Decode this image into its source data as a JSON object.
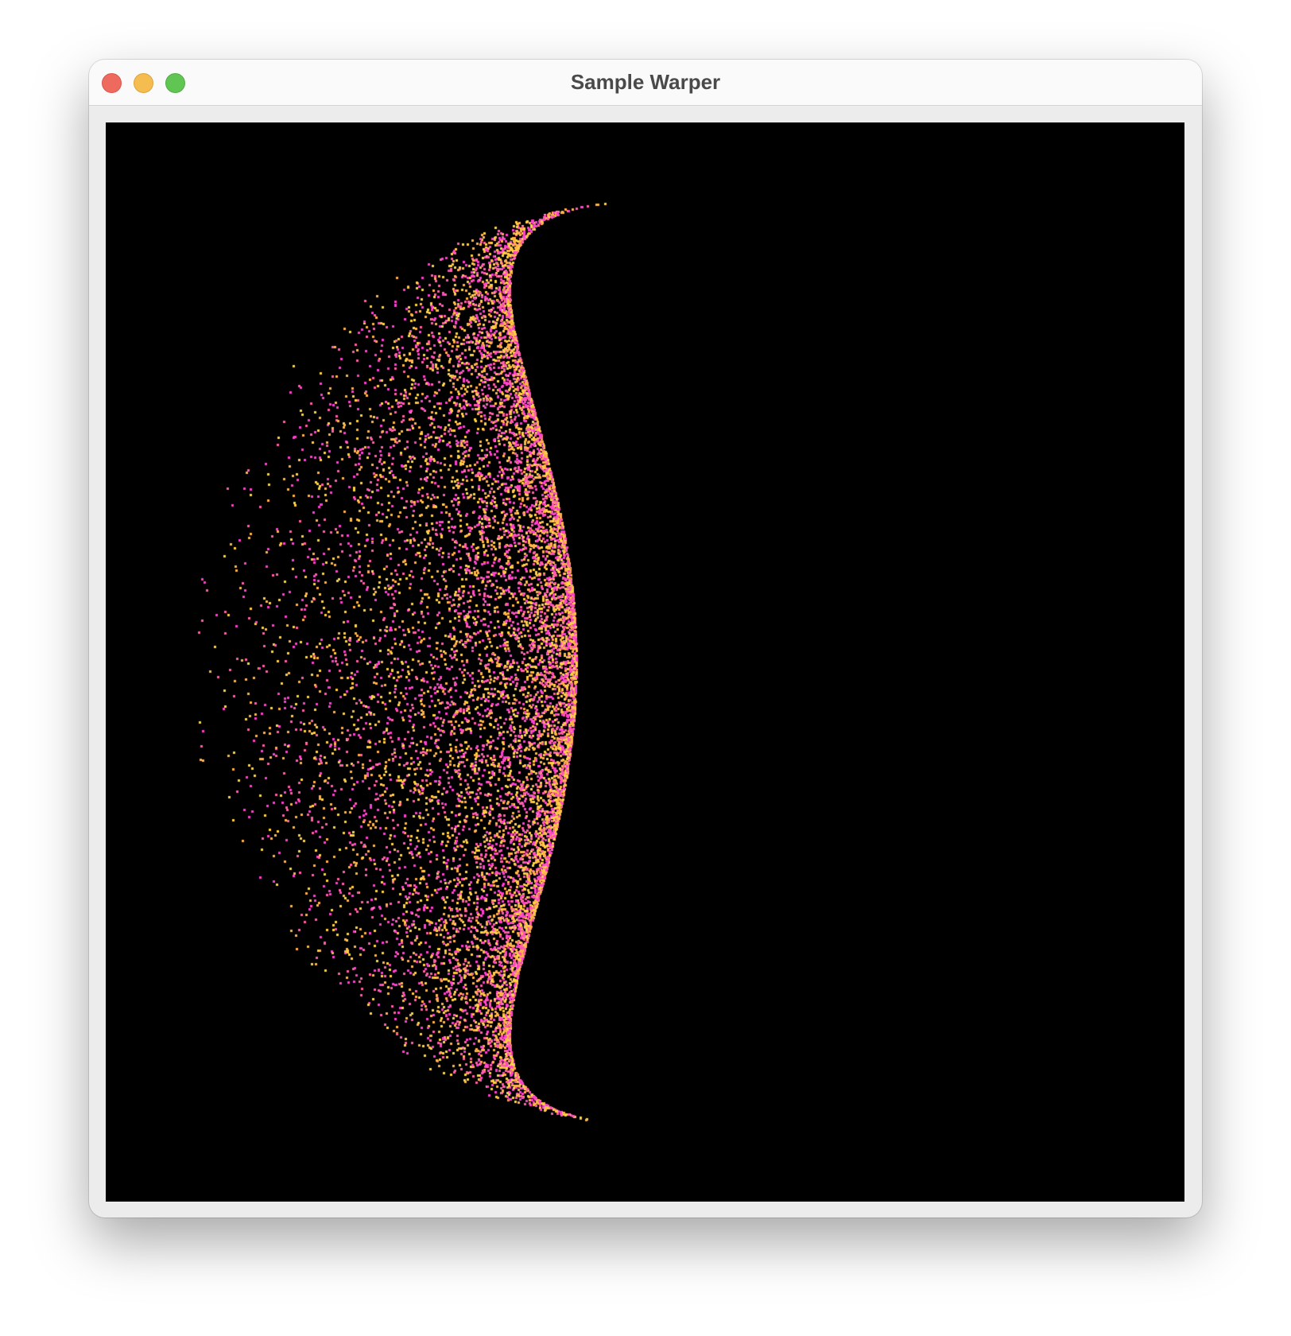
{
  "window": {
    "title": "Sample Warper"
  },
  "controls": {
    "close": "close-button",
    "minimize": "minimize-button",
    "zoom": "zoom-button"
  },
  "visualization": {
    "background": "#000000",
    "point_colors": [
      "#ff3fd0",
      "#ffb347",
      "#ffd23f",
      "#ff5fa8"
    ],
    "shape": "hemisphere",
    "facing": "left"
  }
}
